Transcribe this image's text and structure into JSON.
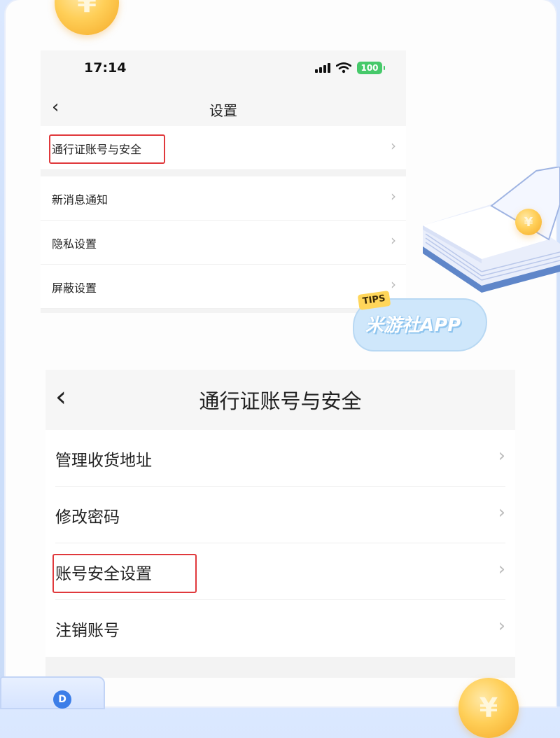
{
  "settings_screen": {
    "status_bar": {
      "time": "17:14",
      "battery": "100"
    },
    "nav": {
      "back_icon": "‹",
      "title": "设置"
    },
    "rows": [
      {
        "label": "通行证账号与安全"
      },
      {
        "label": "新消息通知"
      },
      {
        "label": "隐私设置"
      },
      {
        "label": "屏蔽设置"
      }
    ],
    "chevron": "›"
  },
  "account_screen": {
    "nav": {
      "back_icon": "‹",
      "title": "通行证账号与安全"
    },
    "rows": [
      {
        "label": "管理收货地址"
      },
      {
        "label": "修改密码"
      },
      {
        "label": "账号安全设置"
      },
      {
        "label": "注销账号"
      }
    ],
    "chevron": "›"
  },
  "tips_sticker": {
    "tag": "TIPS",
    "name": "米游社APP"
  },
  "coin_symbol": "¥",
  "corner_logo": "D",
  "colors": {
    "highlight": "#e0393c",
    "battery": "#46c96a",
    "background": "#dbe8ff",
    "coin": "#ffcf58"
  },
  "icons": [
    "back-chevron-icon",
    "forward-chevron-icon",
    "signal-icon",
    "wifi-icon",
    "battery-icon",
    "coin-icon",
    "book-icon"
  ]
}
